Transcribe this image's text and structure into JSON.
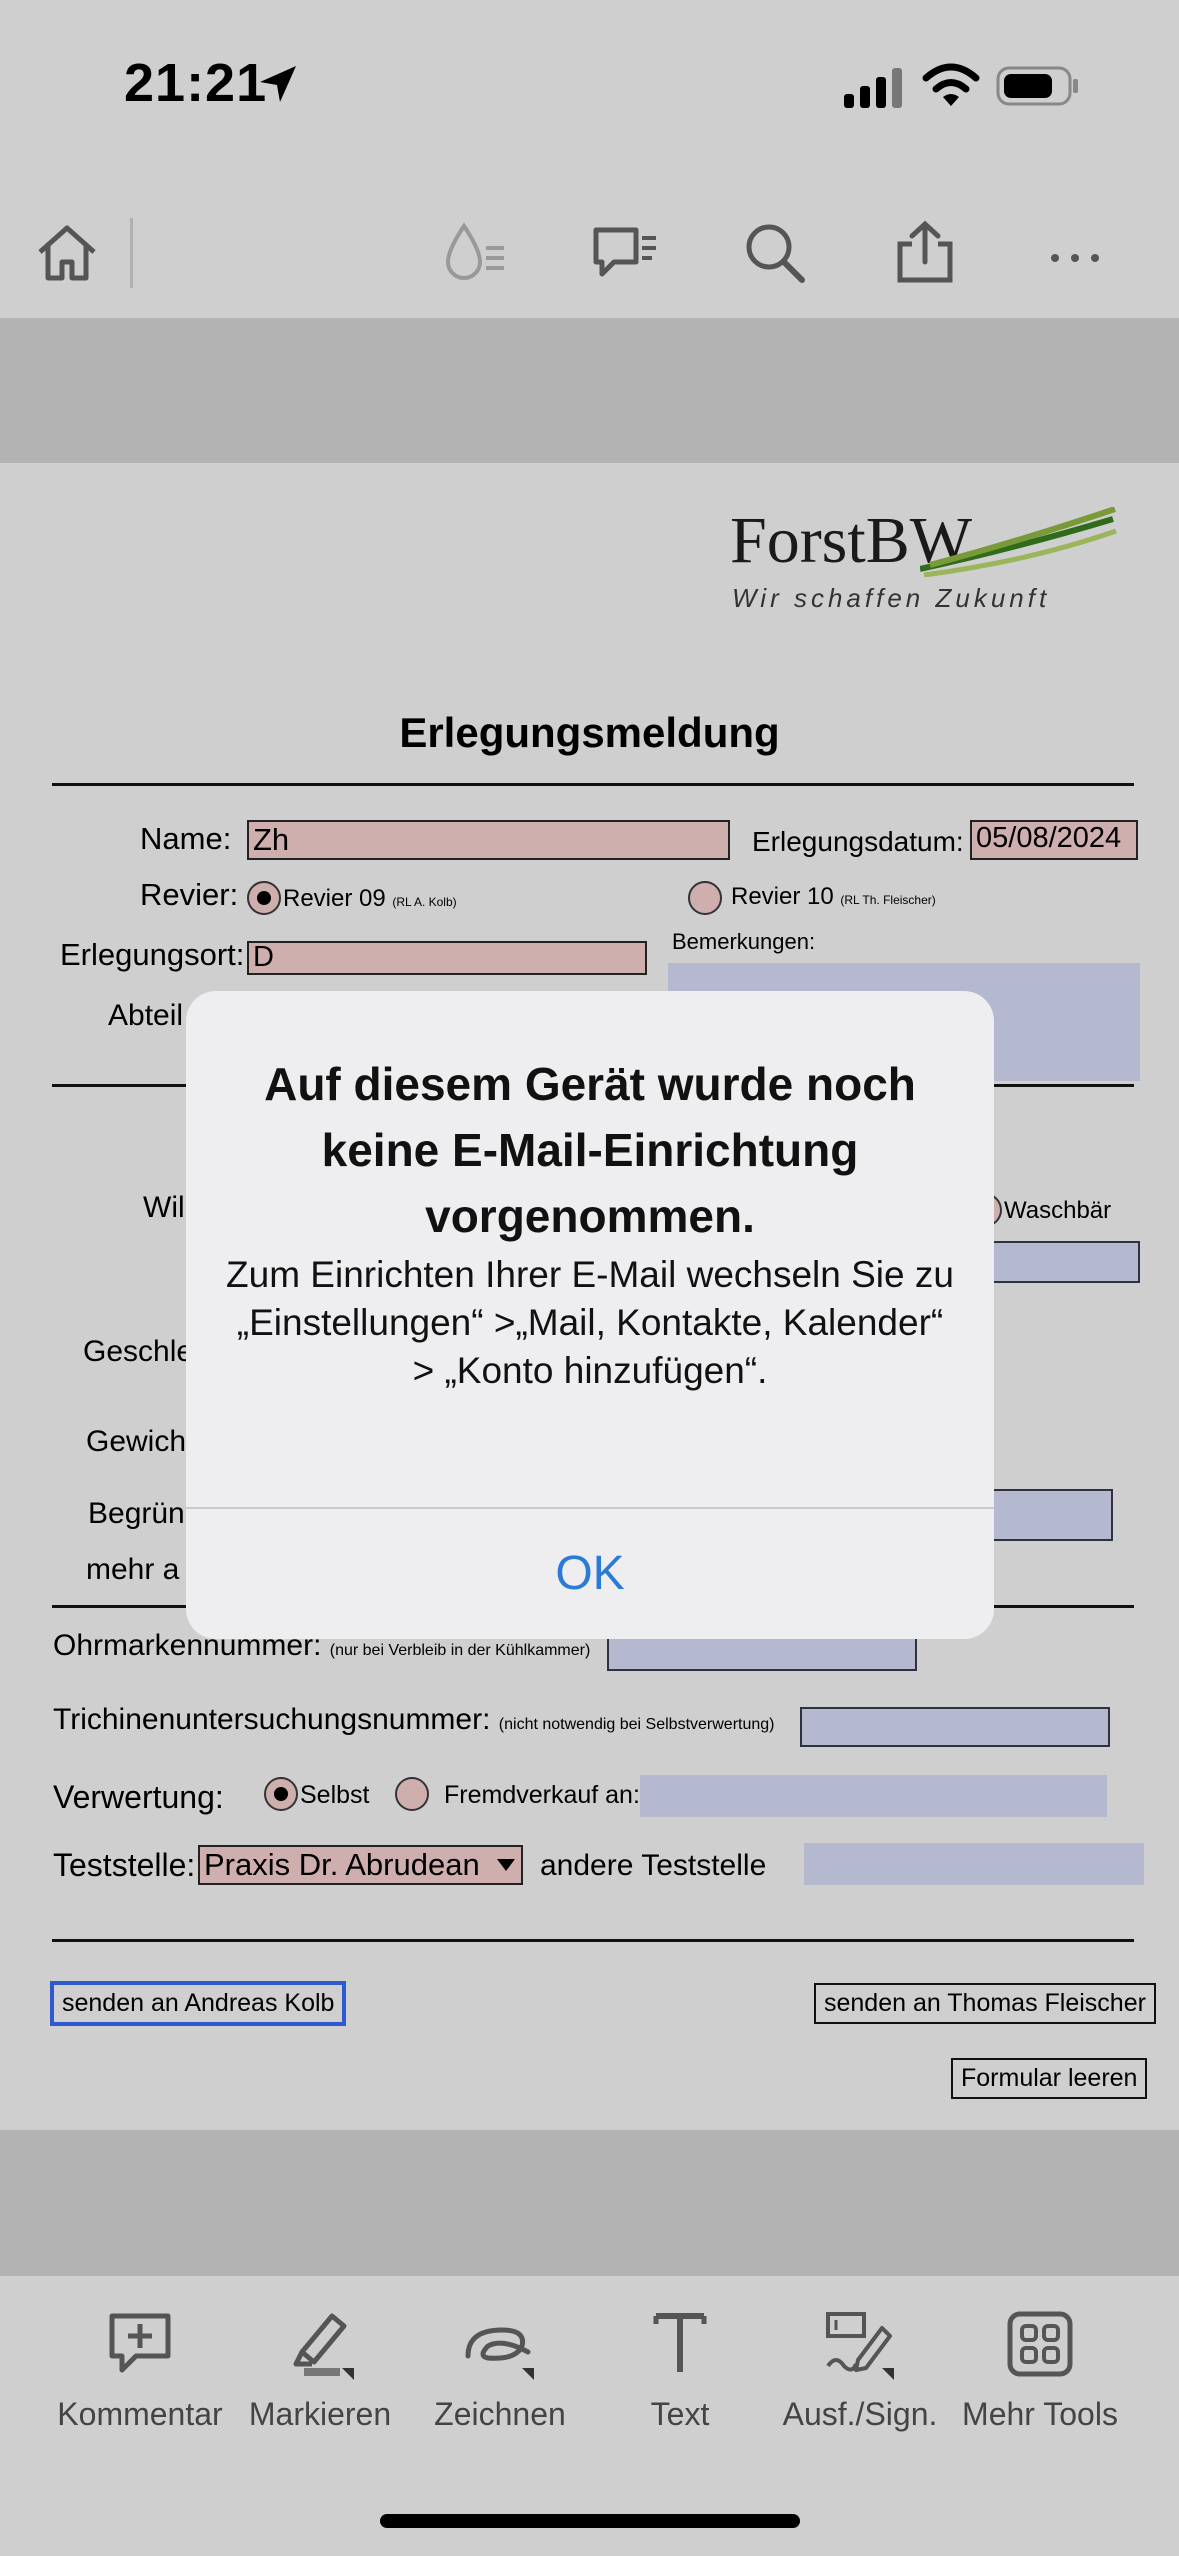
{
  "status": {
    "time": "21:21"
  },
  "document": {
    "logo_name": "ForstBW",
    "logo_tagline": "Wir schaffen Zukunft",
    "title": "Erlegungsmeldung",
    "name_label": "Name:",
    "name_value": "Zh",
    "date_label": "Erlegungsdatum:",
    "date_value": "05/08/2024",
    "revier_label": "Revier:",
    "revier09_label": "Revier 09",
    "revier09_note": "(RL A. Kolb)",
    "revier10_label": "Revier 10",
    "revier10_note": "(RL Th. Fleischer)",
    "ort_label": "Erlegungsort:",
    "ort_value": "D",
    "bemerkungen_label": "Bemerkungen:",
    "abteil_label_partial": "Abteil",
    "wild_label_partial": "Wil",
    "waschbaer_label": "Waschbär",
    "geschl_label_partial": "Geschle",
    "gewicht_label_partial": "Gewich",
    "begruend_label_partial": "Begrün",
    "mehr_label_partial": "mehr a",
    "ohrmarken_label": "Ohrmarkennummer:",
    "ohrmarken_note": "(nur bei Verbleib in der Kühlkammer)",
    "trichinen_label": "Trichinenuntersuchungsnummer:",
    "trichinen_note": "(nicht notwendig bei Selbstverwertung)",
    "verwertung_label": "Verwertung:",
    "selbst_label": "Selbst",
    "fremd_label": "Fremdverkauf an:",
    "teststelle_label": "Teststelle:",
    "teststelle_value": "Praxis Dr. Abrudean",
    "andere_label": "andere Teststelle",
    "send_kolb": "senden an Andreas Kolb",
    "send_fleischer": "senden an Thomas Fleischer",
    "clear_form": "Formular leeren"
  },
  "alert": {
    "title": "Auf diesem Gerät wurde noch keine E-Mail-Einrichtung vorgenommen.",
    "message": "Zum Einrichten Ihrer E-Mail wechseln Sie zu „Einstellungen“ >„Mail, Kontakte, Kalender“ > „Konto hinzufügen“.",
    "ok": "OK"
  },
  "bottom_bar": {
    "items": [
      {
        "label": "Kommentar",
        "icon": "comment-add-icon"
      },
      {
        "label": "Markieren",
        "icon": "highlighter-icon"
      },
      {
        "label": "Zeichnen",
        "icon": "draw-icon"
      },
      {
        "label": "Text",
        "icon": "text-icon"
      },
      {
        "label": "Ausf./Sign.",
        "icon": "fill-sign-icon"
      },
      {
        "label": "Mehr Tools",
        "icon": "more-tools-icon"
      }
    ]
  },
  "colors": {
    "field_pink": "#cfaeae",
    "field_blue": "#b4b9d0",
    "accent_blue": "#2a7ad8",
    "logo_green": "#3d7a1e"
  }
}
